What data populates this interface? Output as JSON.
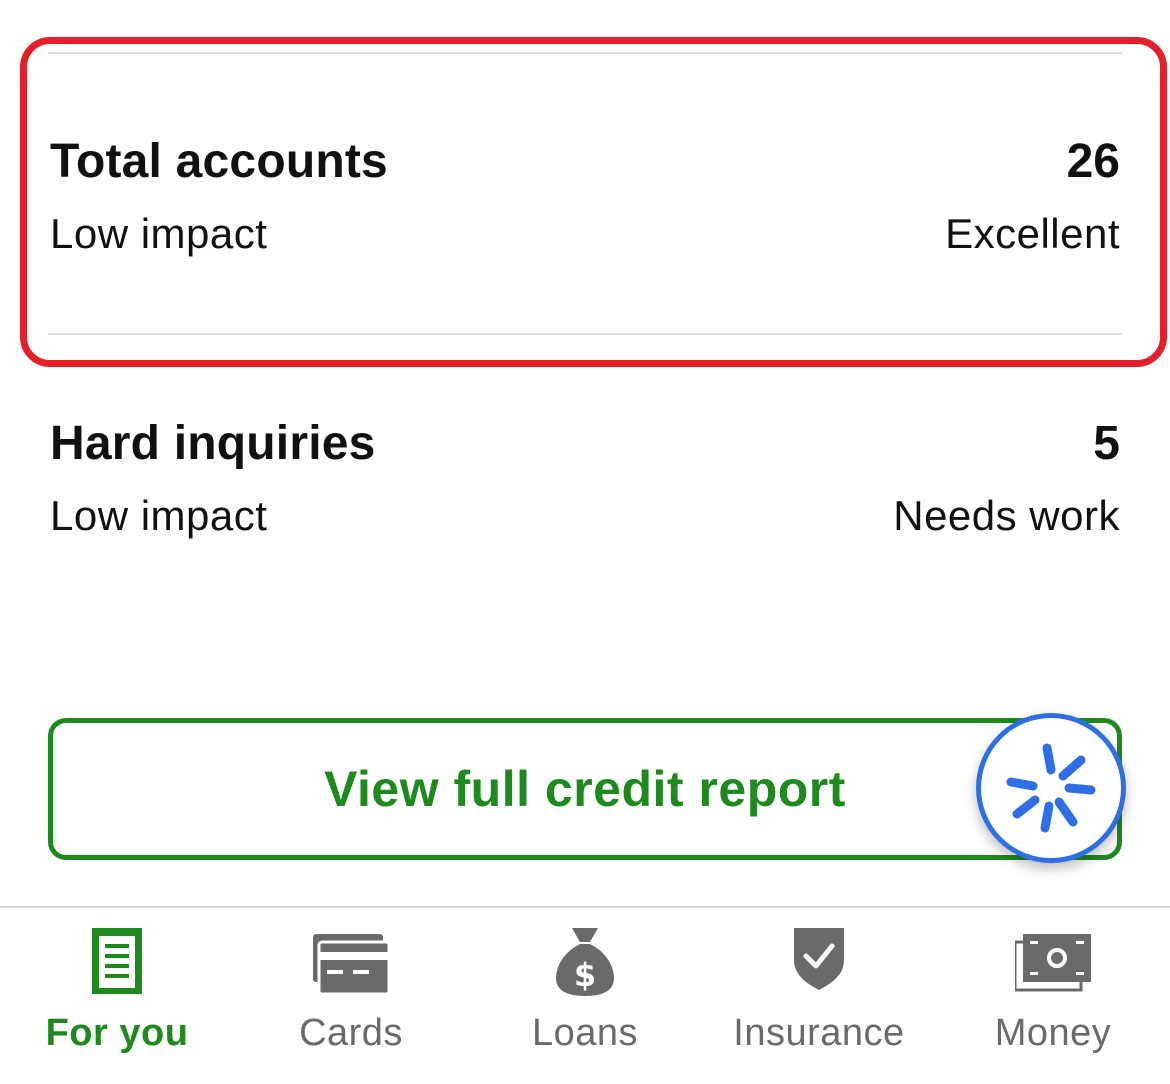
{
  "factors": [
    {
      "title": "Total accounts",
      "value": "26",
      "impact": "Low impact",
      "rating": "Excellent"
    },
    {
      "title": "Hard inquiries",
      "value": "5",
      "impact": "Low impact",
      "rating": "Needs work"
    }
  ],
  "report_button": {
    "label": "View full credit report"
  },
  "tabs": [
    {
      "label": "For you",
      "icon": "document-icon",
      "active": true
    },
    {
      "label": "Cards",
      "icon": "credit-card-icon",
      "active": false
    },
    {
      "label": "Loans",
      "icon": "money-bag-icon",
      "active": false
    },
    {
      "label": "Insurance",
      "icon": "shield-check-icon",
      "active": false
    },
    {
      "label": "Money",
      "icon": "cash-icon",
      "active": false
    }
  ],
  "colors": {
    "highlight": "#e3202a",
    "brand_green": "#1e8a1e",
    "assistant_blue": "#2e6fe6",
    "inactive_gray": "#6a6a6a"
  }
}
